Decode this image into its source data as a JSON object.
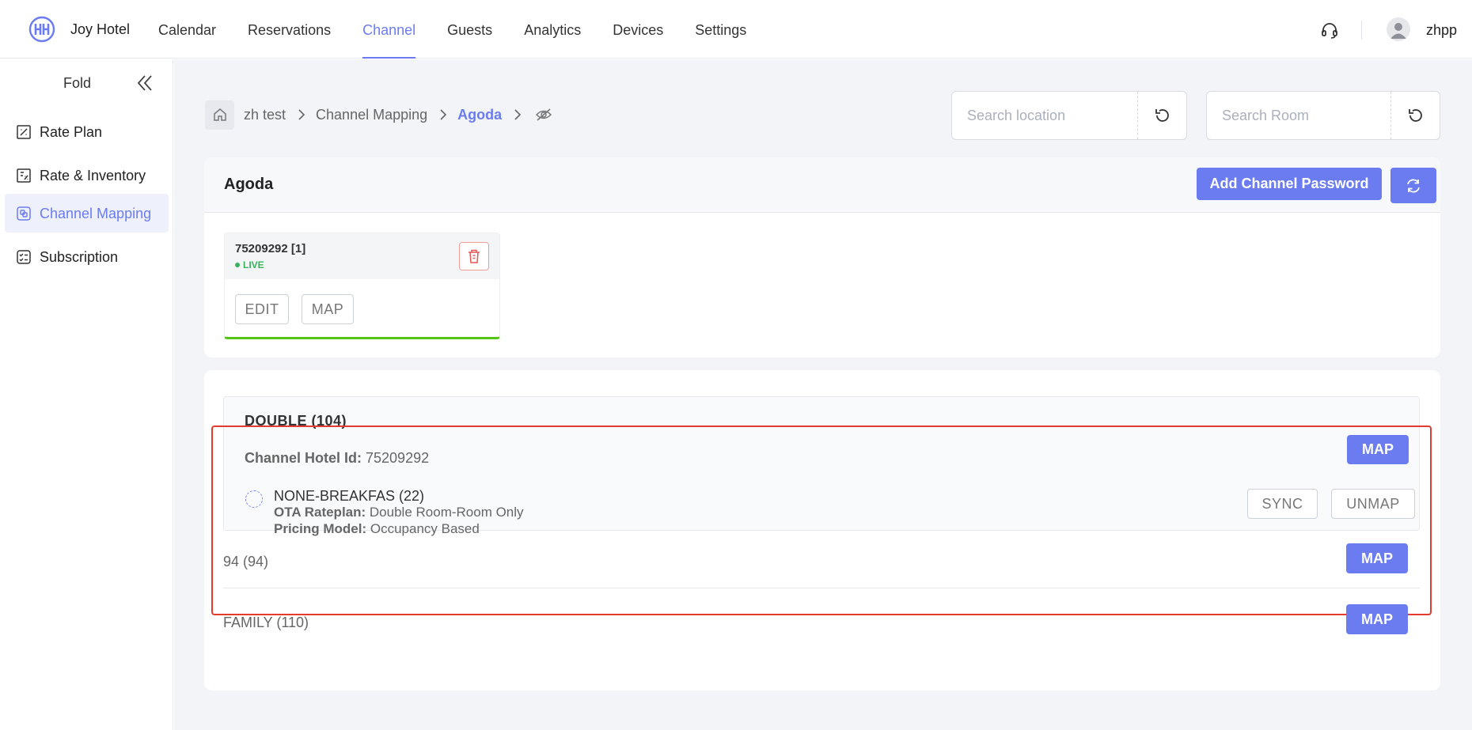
{
  "brand": {
    "name": "Joy Hotel",
    "logo_icon": "hotel-logo-icon"
  },
  "nav": {
    "items": [
      {
        "label": "Calendar"
      },
      {
        "label": "Reservations"
      },
      {
        "label": "Channel",
        "active": true
      },
      {
        "label": "Guests"
      },
      {
        "label": "Analytics"
      },
      {
        "label": "Devices"
      },
      {
        "label": "Settings"
      }
    ]
  },
  "user": {
    "name": "zhpp"
  },
  "sidebar": {
    "fold_label": "Fold",
    "items": [
      {
        "label": "Rate Plan",
        "icon": "rate-plan-icon"
      },
      {
        "label": "Rate & Inventory",
        "icon": "rate-inventory-icon"
      },
      {
        "label": "Channel Mapping",
        "icon": "channel-mapping-icon",
        "active": true
      },
      {
        "label": "Subscription",
        "icon": "subscription-icon"
      }
    ]
  },
  "breadcrumb": {
    "items": [
      "zh test",
      "Channel Mapping",
      "Agoda"
    ]
  },
  "search": {
    "location_placeholder": "Search location",
    "room_placeholder": "Search Room"
  },
  "channel": {
    "title": "Agoda",
    "add_password_label": "Add Channel Password",
    "account": {
      "id": "75209292 [1]",
      "status": "LIVE",
      "edit_label": "EDIT",
      "map_label": "MAP"
    }
  },
  "rooms": {
    "mapped": {
      "title": "DOUBLE (104)",
      "hotel_id_label": "Channel Hotel Id:",
      "hotel_id": "75209292",
      "map_label": "MAP",
      "rate": {
        "name": "NONE-BREAKFAS (22)",
        "ota_label": "OTA Rateplan:",
        "ota_value": "Double Room-Room Only",
        "pricing_label": "Pricing Model:",
        "pricing_value": "Occupancy Based",
        "sync_label": "SYNC",
        "unmap_label": "UNMAP"
      }
    },
    "unmapped": [
      {
        "label": "94 (94)",
        "map_label": "MAP"
      },
      {
        "label": "FAMILY (110)",
        "map_label": "MAP"
      }
    ]
  },
  "colors": {
    "accent": "#6b7cf0",
    "live": "#38b35b",
    "highlight": "#e53a2f"
  }
}
